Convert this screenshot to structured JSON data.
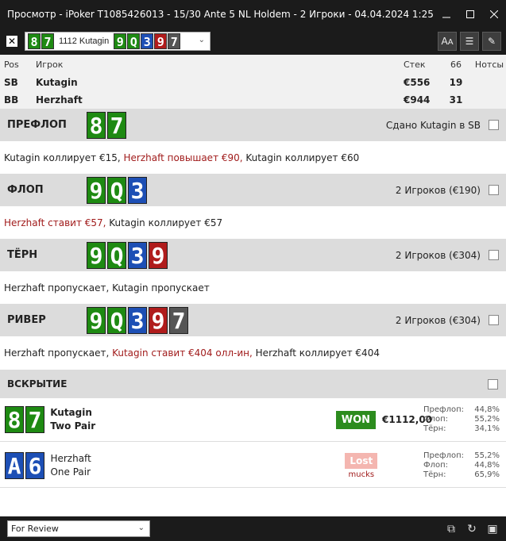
{
  "window": {
    "title": "Просмотр - iPoker T1085426013 - 15/30 Ante 5 NL Holdem - 2 Игроки - 04.04.2024 1:25"
  },
  "toolbar": {
    "hand_cards": [
      {
        "rank": "8",
        "color": "#1e8a12"
      },
      {
        "rank": "7",
        "color": "#1e8a12"
      }
    ],
    "hand_label": "1112 Kutagin",
    "board_cards": [
      {
        "rank": "9",
        "color": "#1e8a12"
      },
      {
        "rank": "Q",
        "color": "#1e8a12"
      },
      {
        "rank": "3",
        "color": "#1d4fb5"
      },
      {
        "rank": "9",
        "color": "#b01c1c"
      },
      {
        "rank": "7",
        "color": "#555555"
      }
    ]
  },
  "players": {
    "headers": {
      "pos": "Pos",
      "player": "Игрок",
      "stack": "Стек",
      "hands": "66",
      "notes": "Нотсы"
    },
    "rows": [
      {
        "pos": "SB",
        "name": "Kutagin",
        "stack": "€556",
        "hands": "19"
      },
      {
        "pos": "BB",
        "name": "Herzhaft",
        "stack": "€944",
        "hands": "31"
      }
    ]
  },
  "streets": {
    "preflop": {
      "name": "ПРЕФЛОП",
      "cards": [
        {
          "rank": "8",
          "color": "#1e8a12"
        },
        {
          "rank": "7",
          "color": "#1e8a12"
        }
      ],
      "info": "Сдано Kutagin в SB",
      "actions": [
        {
          "text": "Kutagin коллирует €15,",
          "raise": false
        },
        {
          "text": "Herzhaft повышает €90,",
          "raise": true
        },
        {
          "text": "Kutagin коллирует €60",
          "raise": false
        }
      ]
    },
    "flop": {
      "name": "ФЛОП",
      "cards": [
        {
          "rank": "9",
          "color": "#1e8a12"
        },
        {
          "rank": "Q",
          "color": "#1e8a12"
        },
        {
          "rank": "3",
          "color": "#1d4fb5"
        }
      ],
      "info": "2 Игроков (€190)",
      "actions": [
        {
          "text": "Herzhaft ставит €57,",
          "raise": true
        },
        {
          "text": "Kutagin коллирует €57",
          "raise": false
        }
      ]
    },
    "turn": {
      "name": "ТЁРН",
      "cards": [
        {
          "rank": "9",
          "color": "#1e8a12"
        },
        {
          "rank": "Q",
          "color": "#1e8a12"
        },
        {
          "rank": "3",
          "color": "#1d4fb5"
        },
        {
          "rank": "9",
          "color": "#b01c1c"
        }
      ],
      "info": "2 Игроков (€304)",
      "actions": [
        {
          "text": "Herzhaft пропускает, Kutagin пропускает",
          "raise": false
        }
      ]
    },
    "river": {
      "name": "РИВЕР",
      "cards": [
        {
          "rank": "9",
          "color": "#1e8a12"
        },
        {
          "rank": "Q",
          "color": "#1e8a12"
        },
        {
          "rank": "3",
          "color": "#1d4fb5"
        },
        {
          "rank": "9",
          "color": "#b01c1c"
        },
        {
          "rank": "7",
          "color": "#555555"
        }
      ],
      "info": "2 Игроков (€304)",
      "actions": [
        {
          "text": "Herzhaft пропускает,",
          "raise": false
        },
        {
          "text": "Kutagin ставит €404 олл-ин,",
          "raise": true
        },
        {
          "text": "Herzhaft коллирует €404",
          "raise": false
        }
      ]
    }
  },
  "showdown": {
    "name": "ВСКРЫТИЕ",
    "players": [
      {
        "cards": [
          {
            "rank": "8",
            "color": "#1e8a12"
          },
          {
            "rank": "7",
            "color": "#1e8a12"
          }
        ],
        "name": "Kutagin",
        "hand": "Two Pair",
        "badge": "WON",
        "amount": "€1112,00",
        "equity": [
          {
            "label": "Префлоп:",
            "value": "44,8%"
          },
          {
            "label": "Флоп:",
            "value": "55,2%"
          },
          {
            "label": "Тёрн:",
            "value": "34,1%"
          }
        ]
      },
      {
        "cards": [
          {
            "rank": "A",
            "color": "#1d4fb5"
          },
          {
            "rank": "6",
            "color": "#1d4fb5"
          }
        ],
        "name": "Herzhaft",
        "hand": "One Pair",
        "badge": "Lost",
        "sub": "mucks",
        "equity": [
          {
            "label": "Префлоп:",
            "value": "55,2%"
          },
          {
            "label": "Флоп:",
            "value": "44,8%"
          },
          {
            "label": "Тёрн:",
            "value": "65,9%"
          }
        ]
      }
    ]
  },
  "footer": {
    "filter_value": "For Review"
  }
}
